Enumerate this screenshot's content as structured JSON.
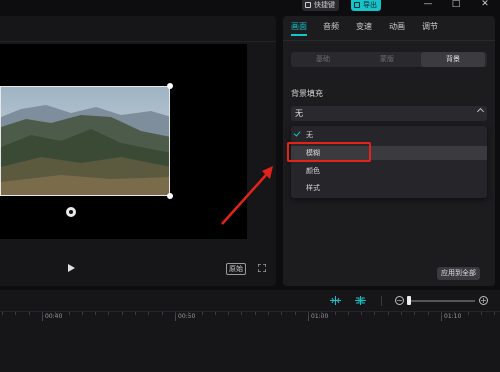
{
  "topbar": {
    "shortcut_label": "快捷键",
    "export_label": "导出",
    "minimize": "—",
    "maximize": "□",
    "close": "✕"
  },
  "player": {
    "ratio_label": "原始"
  },
  "inspector": {
    "tabs": [
      {
        "label": "画面"
      },
      {
        "label": "音频"
      },
      {
        "label": "变速"
      },
      {
        "label": "动画"
      },
      {
        "label": "调节"
      }
    ],
    "subtabs": [
      {
        "label": "基础"
      },
      {
        "label": "蒙版"
      },
      {
        "label": "背景"
      }
    ],
    "bg_fill_label": "背景填充",
    "select_value": "无",
    "options": [
      {
        "label": "无"
      },
      {
        "label": "模糊"
      },
      {
        "label": "颜色"
      },
      {
        "label": "样式"
      }
    ],
    "apply_all_label": "应用到全部"
  },
  "timeline": {
    "ticks": [
      "00:40",
      "00:50",
      "01:00",
      "01:10"
    ]
  },
  "colors": {
    "accent": "#18c2c9",
    "highlight": "#e2231a",
    "panel": "#1c1c1f"
  }
}
